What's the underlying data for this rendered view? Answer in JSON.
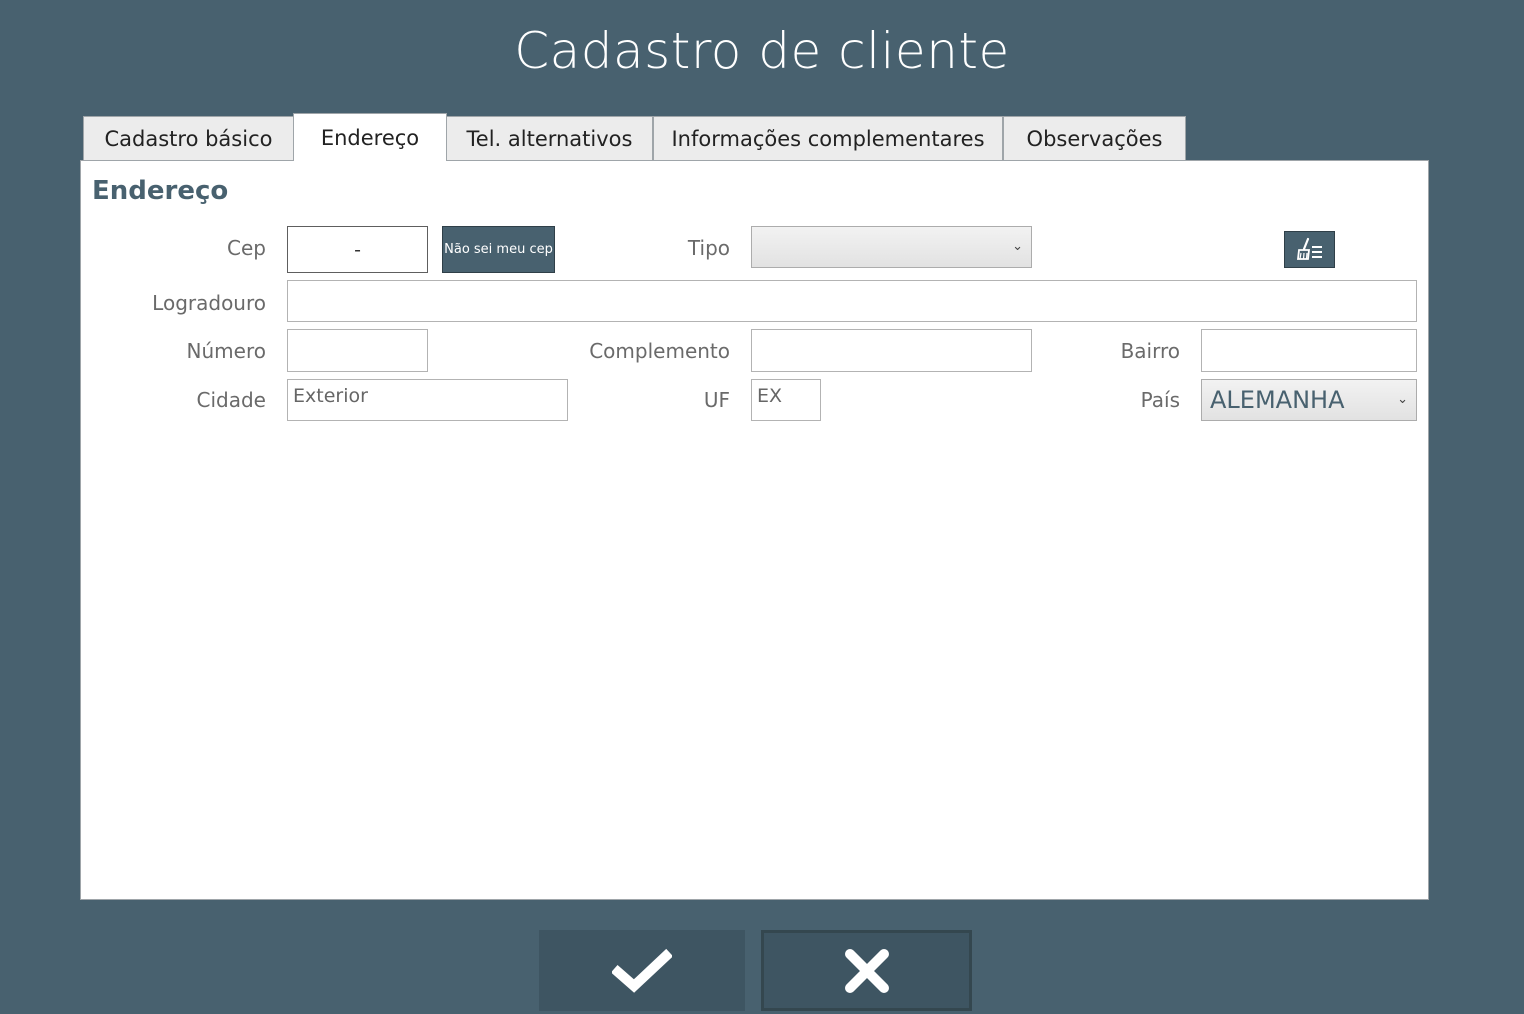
{
  "window": {
    "title": "Cadastro de cliente"
  },
  "tabs": [
    {
      "label": "Cadastro básico"
    },
    {
      "label": "Endereço"
    },
    {
      "label": "Tel. alternativos"
    },
    {
      "label": "Informações complementares"
    },
    {
      "label": "Observações"
    }
  ],
  "active_tab": "Endereço",
  "section": {
    "title": "Endereço"
  },
  "form": {
    "cep": {
      "label": "Cep",
      "value": "-"
    },
    "nao_sei_cep_button": "Não sei meu cep",
    "tipo": {
      "label": "Tipo",
      "value": ""
    },
    "clear_button_icon": "broom-list-icon",
    "logradouro": {
      "label": "Logradouro",
      "value": ""
    },
    "numero": {
      "label": "Número",
      "value": ""
    },
    "complemento": {
      "label": "Complemento",
      "value": ""
    },
    "bairro": {
      "label": "Bairro",
      "value": ""
    },
    "cidade": {
      "label": "Cidade",
      "value": "Exterior"
    },
    "uf": {
      "label": "UF",
      "value": "EX"
    },
    "pais": {
      "label": "País",
      "value": "ALEMANHA"
    }
  },
  "actions": {
    "confirm_icon": "checkmark-icon",
    "cancel_icon": "close-icon"
  },
  "colors": {
    "background": "#48616f",
    "accent": "#48616f",
    "panel": "#ffffff"
  }
}
